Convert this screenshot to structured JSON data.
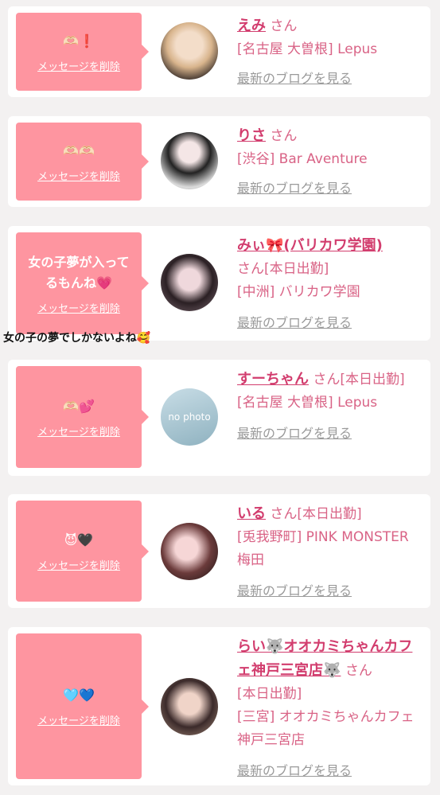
{
  "delete_label": "メッセージを削除",
  "blog_label": "最新のブログを見る",
  "overlay_text": "女の子の夢でしかないよね🥰",
  "cards": [
    {
      "message": "🫶🏻❗",
      "name": "えみ",
      "san": "さん",
      "location": "[名古屋 大曽根] Lepus"
    },
    {
      "message": "🫶🏻🫶🏻",
      "name": "りさ",
      "san": "さん",
      "location": "[渋谷] Bar Aventure"
    },
    {
      "message": "女の子夢が入ってるもんね💗",
      "name": "みぃ🎀(バリカワ学園)",
      "san": "さん[本日出勤]",
      "location": "[中洲] バリカワ学園"
    },
    {
      "message": "🫶🏻💕",
      "name": "すーちゃん",
      "san": "さん[本日出勤]",
      "location": "[名古屋 大曽根] Lepus",
      "avatar_text": "no photo"
    },
    {
      "message": "😈🖤",
      "name": "いる",
      "san": "さん[本日出勤]",
      "location": "[兎我野町] PINK MONSTER梅田"
    },
    {
      "message": "🩵💙",
      "name": "らい🐺オオカミちゃんカフェ神戸三宮店🐺",
      "san": "さん",
      "location_prefix": "[本日出勤]",
      "location": "[三宮] オオカミちゃんカフェ神戸三宮店"
    }
  ]
}
